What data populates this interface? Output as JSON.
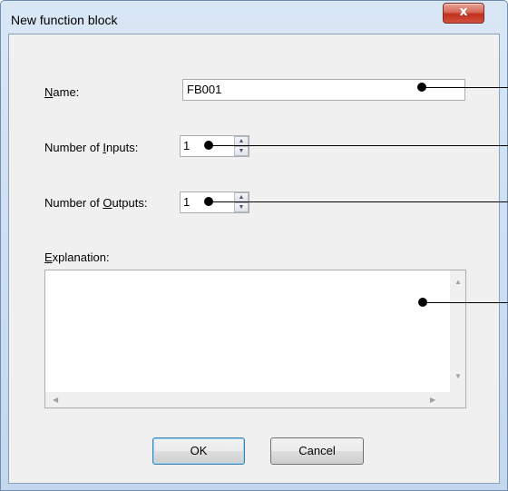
{
  "window": {
    "title": "New function block",
    "close_glyph": "x"
  },
  "form": {
    "name_label_accel": "N",
    "name_label_rest": "ame:",
    "name_value": "FB001",
    "inputs_label_pre": "Number of ",
    "inputs_label_accel": "I",
    "inputs_label_post": "nputs:",
    "inputs_value": "1",
    "outputs_label_pre": "Number of ",
    "outputs_label_accel": "O",
    "outputs_label_post": "utputs:",
    "outputs_value": "1",
    "explanation_label_accel": "E",
    "explanation_label_rest": "xplanation:",
    "explanation_value": ""
  },
  "buttons": {
    "ok": "OK",
    "cancel": "Cancel"
  },
  "icons": {
    "spin_up": "triangle-up-icon",
    "spin_down": "triangle-down-icon",
    "scroll_up": "scroll-up-arrow-icon",
    "scroll_down": "scroll-down-arrow-icon",
    "scroll_left": "scroll-left-arrow-icon",
    "scroll_right": "scroll-right-arrow-icon"
  },
  "colors": {
    "title_gradient_top": "#d9e7f5",
    "close_red": "#c1301d",
    "client_bg": "#f0f0f0",
    "default_button_border": "#3c7fb1"
  }
}
